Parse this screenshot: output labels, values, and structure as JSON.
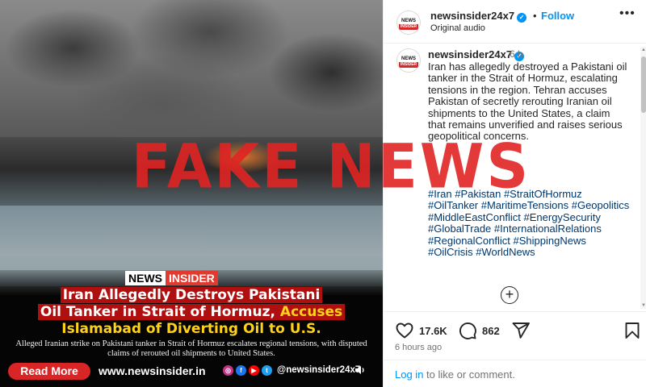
{
  "media": {
    "logo_news": "NEWS",
    "logo_insider": "INSIDER",
    "headline_line1": "Iran Allegedly Destroys Pakistani",
    "headline_line2_white": "Oil Tanker in Strait of Hormuz,",
    "headline_line2_accent": "Accuses",
    "headline_line3": "Islamabad of Diverting Oil to U.S.",
    "subcaption": "Alleged Iranian strike on Pakistani tanker in Strait of Hormuz escalates regional tensions, with disputed claims of rerouted oil shipments to United States.",
    "read_more": "Read More",
    "site_url": "www.newsinsider.in",
    "social_handle": "@newsinsider24x7",
    "social_icons": [
      "instagram-icon",
      "facebook-icon",
      "youtube-icon",
      "twitter-icon"
    ],
    "colors": {
      "headline_bg": "#b00f0f",
      "accent": "#ffd21a",
      "read_more_bg": "#d92525"
    }
  },
  "overlay": {
    "text": "FAKE NEWS",
    "color": "#e02323"
  },
  "header": {
    "username": "newsinsider24x7",
    "separator": "•",
    "follow": "Follow",
    "subline": "Original audio",
    "avatar_top": "NEWS",
    "avatar_bottom": "INSIDER"
  },
  "comment": {
    "username": "newsinsider24x7",
    "time": "6 h",
    "caption": "Iran has allegedly destroyed a Pakistani oil tanker in the Strait of Hormuz, escalating tensions in the region. Tehran accuses Pakistan of secretly rerouting Iranian oil shipments to the United States, a claim that remains unverified and raises serious geopolitical concerns.",
    "hashtags": "#Iran #Pakistan #StraitOfHormuz #OilTanker #MaritimeTensions #Geopolitics #MiddleEastConflict #EnergySecurity #GlobalTrade #InternationalRelations #RegionalConflict #ShippingNews #OilCrisis #WorldNews"
  },
  "actions": {
    "likes": "17.6K",
    "comments": "862",
    "posted": "6 hours ago"
  },
  "footer": {
    "login_link": "Log in",
    "login_rest": " to like or comment."
  }
}
